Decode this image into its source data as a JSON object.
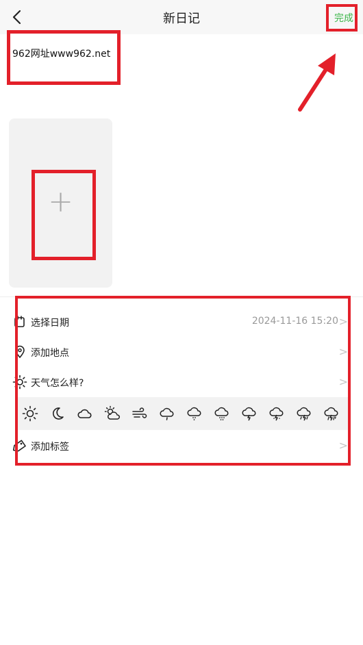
{
  "header": {
    "title": "新日记",
    "done_label": "完成"
  },
  "editor": {
    "text": "962网址www962.net"
  },
  "photo": {
    "add_symbol": "+"
  },
  "options": [
    {
      "label": "选择日期",
      "value": "2024-11-16 15:20",
      "icon": "calendar-icon"
    },
    {
      "label": "添加地点",
      "value": "",
      "icon": "location-pin-icon"
    },
    {
      "label": "天气怎么样?",
      "value": "",
      "icon": "sun-icon"
    },
    {
      "label": "添加标签",
      "value": "",
      "icon": "tag-icon"
    }
  ],
  "chevron": ">",
  "weather_icons": [
    "sunny-icon",
    "moon-icon",
    "cloudy-icon",
    "partly-cloudy-icon",
    "windy-icon",
    "light-rain-icon",
    "rain-icon",
    "heavy-rain-icon",
    "thunder-icon",
    "thunder-rain-icon",
    "storm-icon",
    "hail-icon"
  ],
  "colors": {
    "accent": "#3cb64a",
    "highlight": "#e3202a"
  }
}
